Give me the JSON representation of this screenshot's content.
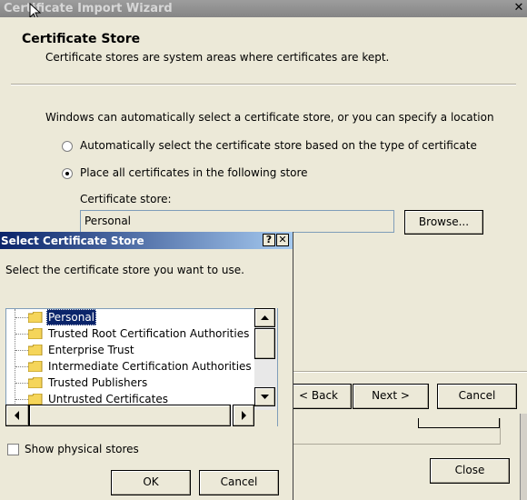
{
  "wizard": {
    "title": "Certificate Import Wizard",
    "close_glyph": "✕",
    "header": {
      "title": "Certificate Store",
      "subtitle": "Certificate stores are system areas where certificates are kept."
    },
    "intro": "Windows can automatically select a certificate store, or you can specify a location",
    "radio_auto_label": "Automatically select the certificate store based on the type of certificate",
    "radio_place_label": "Place all certificates in the following store",
    "radio_selected": "place",
    "store_label": "Certificate store:",
    "store_value": "Personal",
    "browse_label": "Browse...",
    "back_label": "< Back",
    "next_label": "Next >",
    "cancel_label": "Cancel"
  },
  "background_window": {
    "close_label": "Close"
  },
  "dialog": {
    "title": "Select Certificate Store",
    "help_glyph": "?",
    "close_glyph": "✕",
    "instruction": "Select the certificate store you want to use.",
    "stores": [
      {
        "label": "Personal",
        "selected": true
      },
      {
        "label": "Trusted Root Certification Authorities",
        "selected": false
      },
      {
        "label": "Enterprise Trust",
        "selected": false
      },
      {
        "label": "Intermediate Certification Authorities",
        "selected": false
      },
      {
        "label": "Trusted Publishers",
        "selected": false
      },
      {
        "label": "Untrusted Certificates",
        "selected": false
      }
    ],
    "show_physical_label": "Show physical stores",
    "show_physical_checked": false,
    "ok_label": "OK",
    "cancel_label": "Cancel"
  },
  "colors": {
    "selection": "#0a246a",
    "folder": "#f5d55a",
    "window_bg": "#ece9d8"
  }
}
